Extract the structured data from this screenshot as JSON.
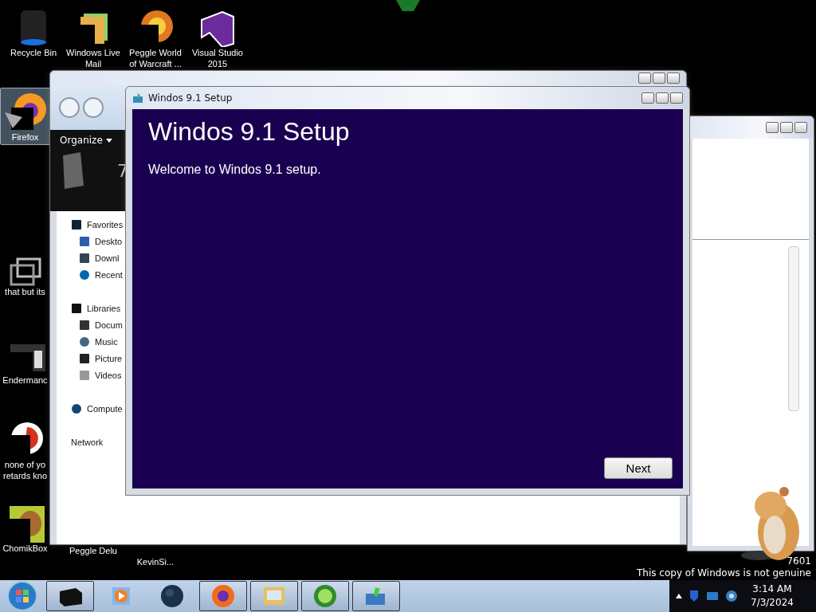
{
  "desktop_icons": [
    {
      "kind": "bin",
      "lines": [
        "Recycle Bin"
      ],
      "selected": false
    },
    {
      "kind": "mail",
      "lines": [
        "Windows Live",
        "Mail"
      ],
      "selected": false
    },
    {
      "kind": "peggle",
      "lines": [
        "Peggle World",
        "of Warcraft ..."
      ],
      "selected": false
    },
    {
      "kind": "vs",
      "lines": [
        "Visual Studio",
        "2015"
      ],
      "selected": false
    },
    {
      "kind": "firefox",
      "lines": [
        "Firefox"
      ],
      "selected": true
    },
    {
      "kind": "shortcut",
      "lines": [
        "that but its"
      ],
      "selected": false
    },
    {
      "kind": "screen",
      "lines": [
        "Endermanc"
      ],
      "selected": false
    },
    {
      "kind": "swirl",
      "lines": [
        "none of yo",
        "retards kno"
      ],
      "selected": false
    },
    {
      "kind": "chomik",
      "lines": [
        "ChomikBox"
      ],
      "selected": false
    },
    {
      "kind": "none",
      "lines": [
        "Peggle Delu"
      ],
      "selected": false
    },
    {
      "kind": "none",
      "lines": [
        "KevinSi..."
      ],
      "selected": false
    }
  ],
  "explorer": {
    "organize": "Organize",
    "header_text": "7",
    "nav": [
      {
        "label": "Favorites",
        "children": [
          {
            "label": "Deskto"
          },
          {
            "label": "Downl"
          },
          {
            "label": "Recent"
          }
        ]
      },
      {
        "label": "Libraries",
        "children": [
          {
            "label": "Docum"
          },
          {
            "label": "Music"
          },
          {
            "label": "Picture"
          },
          {
            "label": "Videos"
          }
        ]
      },
      {
        "label": "Compute"
      },
      {
        "label": "Network"
      }
    ]
  },
  "setup": {
    "title": "Windos 9.1 Setup",
    "heading": "Windos 9.1 Setup",
    "welcome": "Welcome to Windos 9.1 setup.",
    "next": "Next"
  },
  "watermark": {
    "build": "7601",
    "genuine": "This copy of Windows is not genuine"
  },
  "taskbar": {
    "items": [
      {
        "kind": "box",
        "running": true
      },
      {
        "kind": "media",
        "running": false
      },
      {
        "kind": "globe",
        "running": false
      },
      {
        "kind": "firefox",
        "running": true
      },
      {
        "kind": "folder",
        "running": true
      },
      {
        "kind": "green",
        "running": true
      },
      {
        "kind": "setup",
        "running": true
      }
    ],
    "time": "3:14 AM",
    "date": "7/3/2024"
  }
}
